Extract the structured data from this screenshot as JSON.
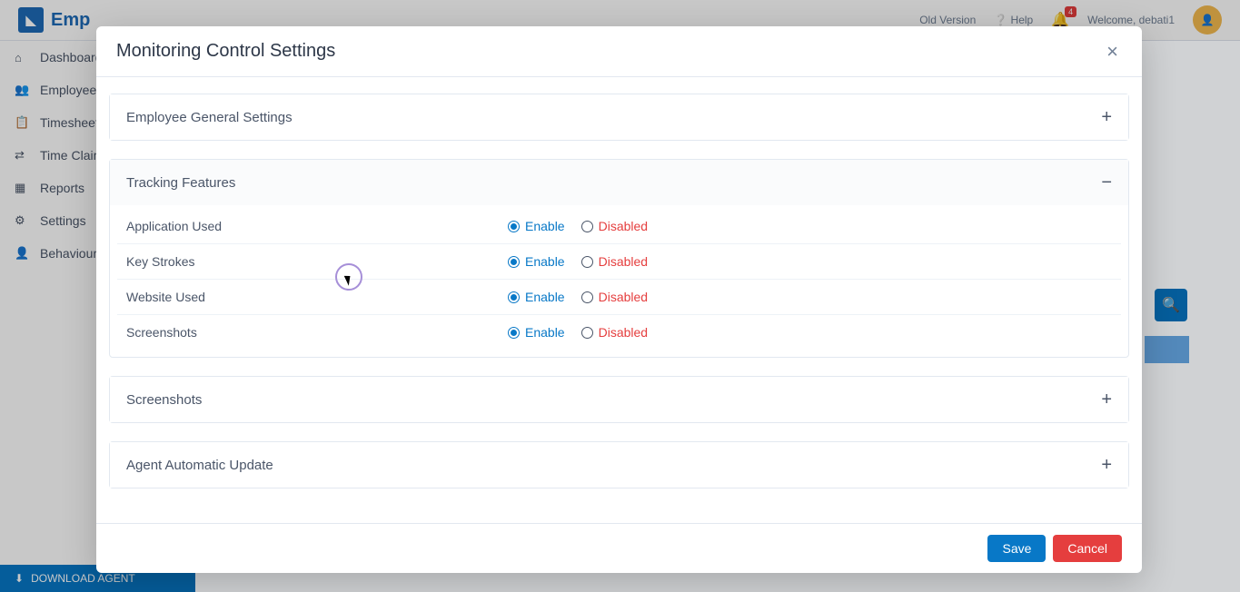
{
  "header": {
    "brand_prefix": "Emp",
    "old_version": "Old Version",
    "help": "Help",
    "notif_count": "4",
    "welcome": "Welcome, debati1"
  },
  "sidebar": {
    "items": [
      {
        "icon": "⌂",
        "label": "Dashboard"
      },
      {
        "icon": "👥",
        "label": "Employee"
      },
      {
        "icon": "📋",
        "label": "Timesheets"
      },
      {
        "icon": "⇄",
        "label": "Time Claim"
      },
      {
        "icon": "▦",
        "label": "Reports"
      },
      {
        "icon": "⚙",
        "label": "Settings"
      },
      {
        "icon": "👤",
        "label": "Behaviour"
      }
    ],
    "download_agent": "DOWNLOAD AGENT"
  },
  "modal": {
    "title": "Monitoring Control Settings",
    "sections": [
      {
        "title": "Employee General Settings",
        "expanded": false
      },
      {
        "title": "Tracking Features",
        "expanded": true,
        "features": [
          {
            "label": "Application Used",
            "value": "enable"
          },
          {
            "label": "Key Strokes",
            "value": "enable"
          },
          {
            "label": "Website Used",
            "value": "enable"
          },
          {
            "label": "Screenshots",
            "value": "enable"
          }
        ]
      },
      {
        "title": "Screenshots",
        "expanded": false
      },
      {
        "title": "Agent Automatic Update",
        "expanded": false
      }
    ],
    "labels": {
      "enable": "Enable",
      "disabled": "Disabled"
    },
    "buttons": {
      "save": "Save",
      "cancel": "Cancel"
    }
  }
}
